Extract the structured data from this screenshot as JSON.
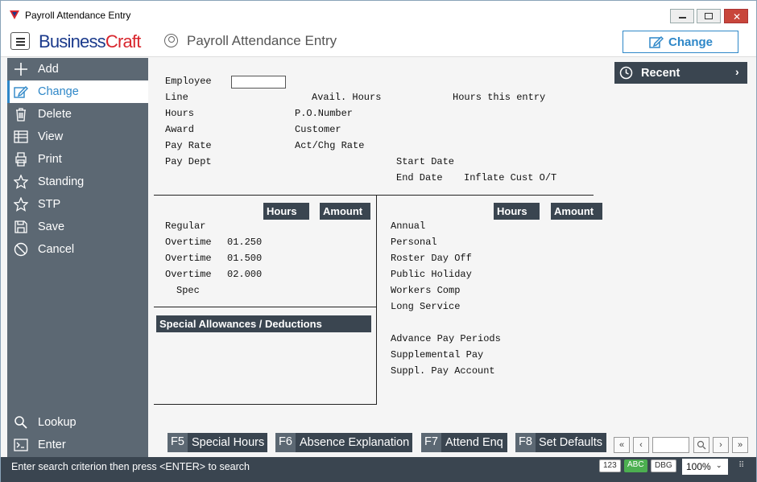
{
  "window": {
    "title": "Payroll Attendance Entry"
  },
  "appbar": {
    "brand_a": "Business",
    "brand_b": "Craft",
    "title": "Payroll Attendance Entry",
    "mode_button": "Change"
  },
  "sidebar": {
    "items": [
      {
        "label": "Add",
        "icon": "plus-icon"
      },
      {
        "label": "Change",
        "icon": "edit-icon"
      },
      {
        "label": "Delete",
        "icon": "trash-icon"
      },
      {
        "label": "View",
        "icon": "table-icon"
      },
      {
        "label": "Print",
        "icon": "printer-icon"
      },
      {
        "label": "Standing",
        "icon": "star-icon"
      },
      {
        "label": "STP",
        "icon": "star-icon"
      },
      {
        "label": "Save",
        "icon": "save-icon"
      },
      {
        "label": "Cancel",
        "icon": "cancel-icon"
      }
    ],
    "bottom": [
      {
        "label": "Lookup",
        "icon": "search-icon"
      },
      {
        "label": "Enter",
        "icon": "enter-icon"
      }
    ]
  },
  "form": {
    "employee": "Employee",
    "employee_value": "",
    "line": "Line",
    "avail_hours": "Avail. Hours",
    "hours_this_entry": "Hours this entry",
    "hours": "Hours",
    "po_number": "P.O.Number",
    "award": "Award",
    "customer": "Customer",
    "pay_rate": "Pay Rate",
    "act_chg_rate": "Act/Chg Rate",
    "pay_dept": "Pay Dept",
    "start_date": "Start Date",
    "end_date": "End Date",
    "inflate_cust": "Inflate Cust O/T"
  },
  "left_grid": {
    "hours_header": "Hours",
    "amount_header": "Amount",
    "rows": [
      "Regular",
      "Overtime",
      "Overtime",
      "Overtime",
      "Spec"
    ],
    "rates": [
      "01.250",
      "01.500",
      "02.000"
    ]
  },
  "right_grid": {
    "hours_header": "Hours",
    "amount_header": "Amount",
    "rows": [
      "Annual",
      "Personal",
      "Roster Day Off",
      "Public Holiday",
      "Workers Comp",
      "Long Service"
    ],
    "rows2": [
      "Advance Pay Periods",
      "Supplemental Pay",
      "Suppl. Pay Account"
    ]
  },
  "allowances_header": "Special Allowances / Deductions",
  "recent": "Recent",
  "fkeys": [
    {
      "key": "F5",
      "label": "Special Hours"
    },
    {
      "key": "F6",
      "label": "Absence Explanation"
    },
    {
      "key": "F7",
      "label": "Attend Enq"
    },
    {
      "key": "F8",
      "label": "Set Defaults"
    }
  ],
  "status": {
    "message": "Enter search criterion then press <ENTER> to search",
    "pill_123": "123",
    "pill_abc": "ABC",
    "pill_dbg": "DBG",
    "zoom": "100%"
  }
}
